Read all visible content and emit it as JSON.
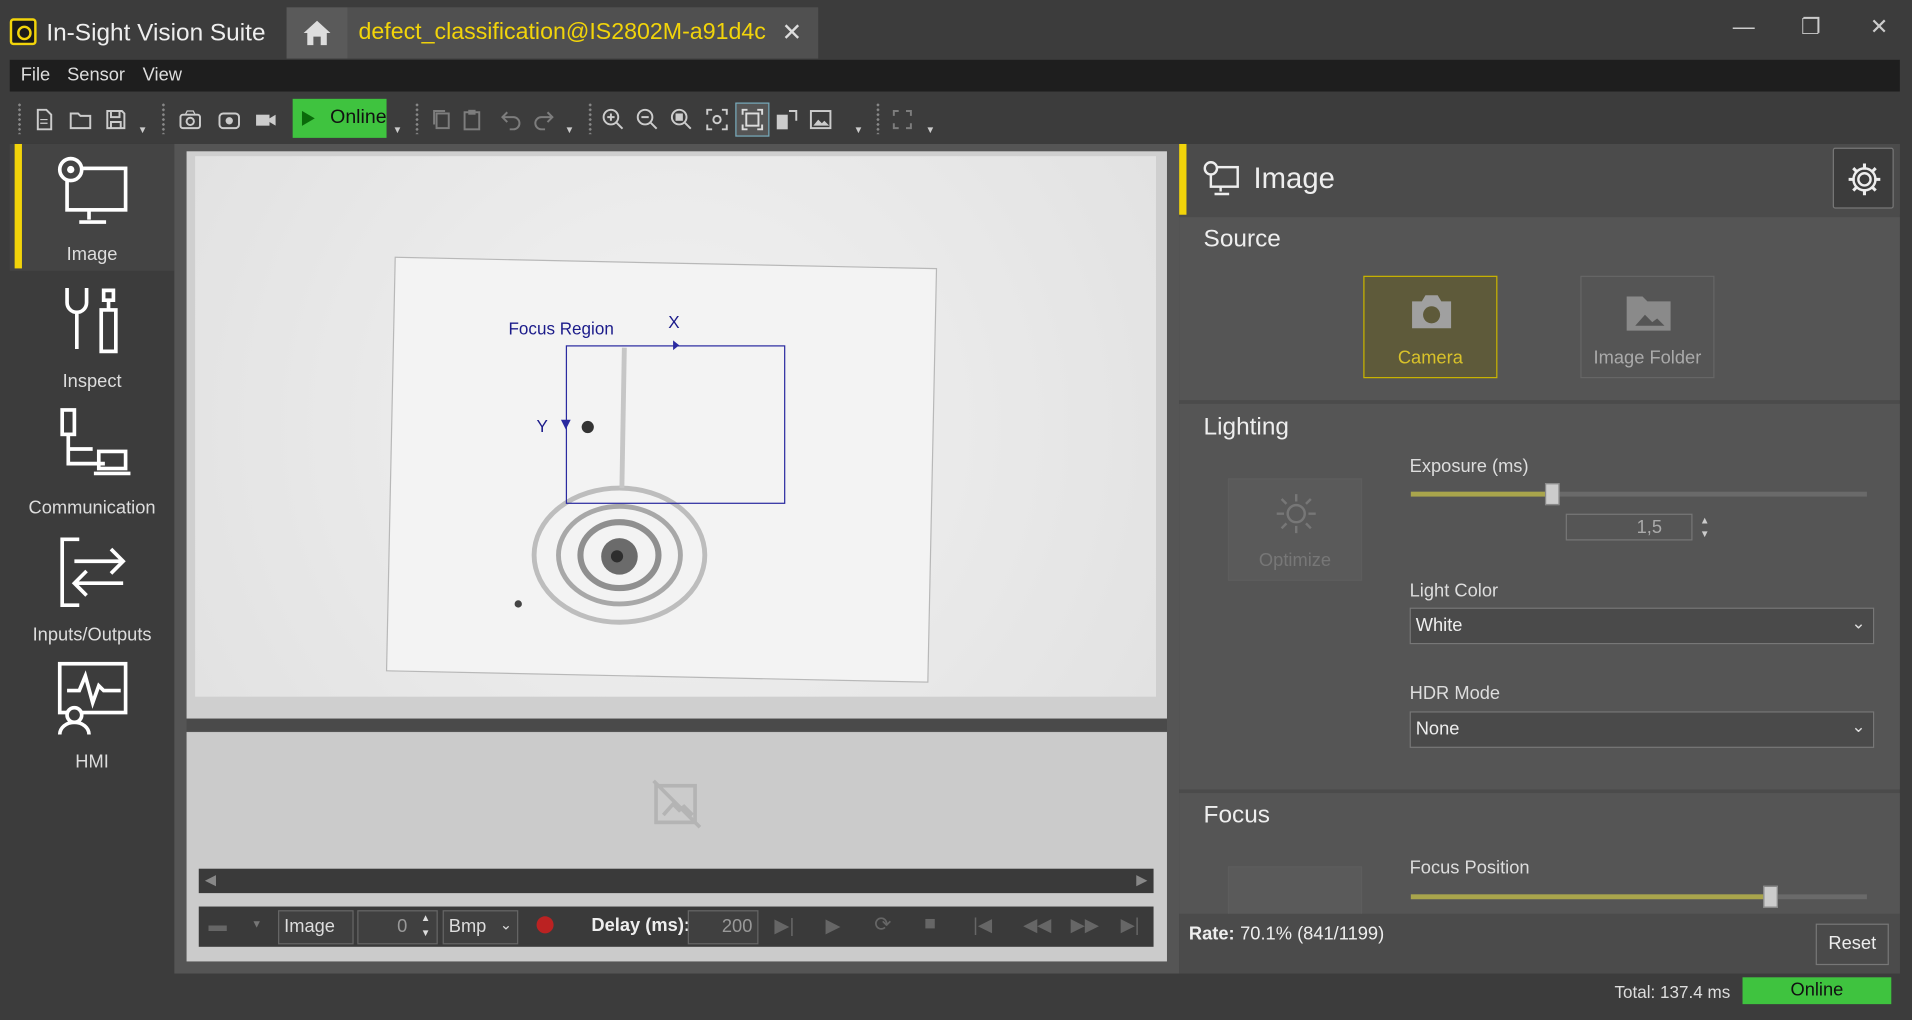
{
  "app": {
    "title": "In-Sight Vision Suite"
  },
  "tabs": {
    "document": "defect_classification@IS2802M-a91d4c"
  },
  "menu": [
    "File",
    "Sensor",
    "View"
  ],
  "toolbar": {
    "online_label": "Online"
  },
  "nav": [
    {
      "label": "Image",
      "icon": "image-settings-icon"
    },
    {
      "label": "Inspect",
      "icon": "tools-icon"
    },
    {
      "label": "Communication",
      "icon": "network-icon"
    },
    {
      "label": "Inputs/Outputs",
      "icon": "io-arrows-icon"
    },
    {
      "label": "HMI",
      "icon": "hmi-icon"
    }
  ],
  "viewer": {
    "focus_region_label": "Focus Region",
    "x_label": "X",
    "y_label": "Y"
  },
  "playbar": {
    "image_label": "Image",
    "index_value": "0",
    "format_value": "Bmp",
    "delay_label": "Delay (ms):",
    "delay_value": "200"
  },
  "panel": {
    "title": "Image",
    "source": {
      "title": "Source",
      "camera_label": "Camera",
      "folder_label": "Image Folder",
      "selected": "Camera"
    },
    "lighting": {
      "title": "Lighting",
      "optimize_label": "Optimize",
      "exposure_label": "Exposure (ms)",
      "exposure_value": "1,5",
      "exposure_fraction": 0.31,
      "light_color_label": "Light Color",
      "light_color_value": "White",
      "hdr_label": "HDR Mode",
      "hdr_value": "None"
    },
    "focus": {
      "title": "Focus",
      "position_label": "Focus Position",
      "position_fraction": 0.79
    },
    "rate_label": "Rate:",
    "rate_value": "70.1% (841/1199)",
    "reset_label": "Reset"
  },
  "status": {
    "total": "Total: 137.4 ms",
    "state": "Online"
  },
  "colors": {
    "accent": "#f2d40a",
    "online": "#3fc33f",
    "overlay": "#2a2aa0"
  }
}
